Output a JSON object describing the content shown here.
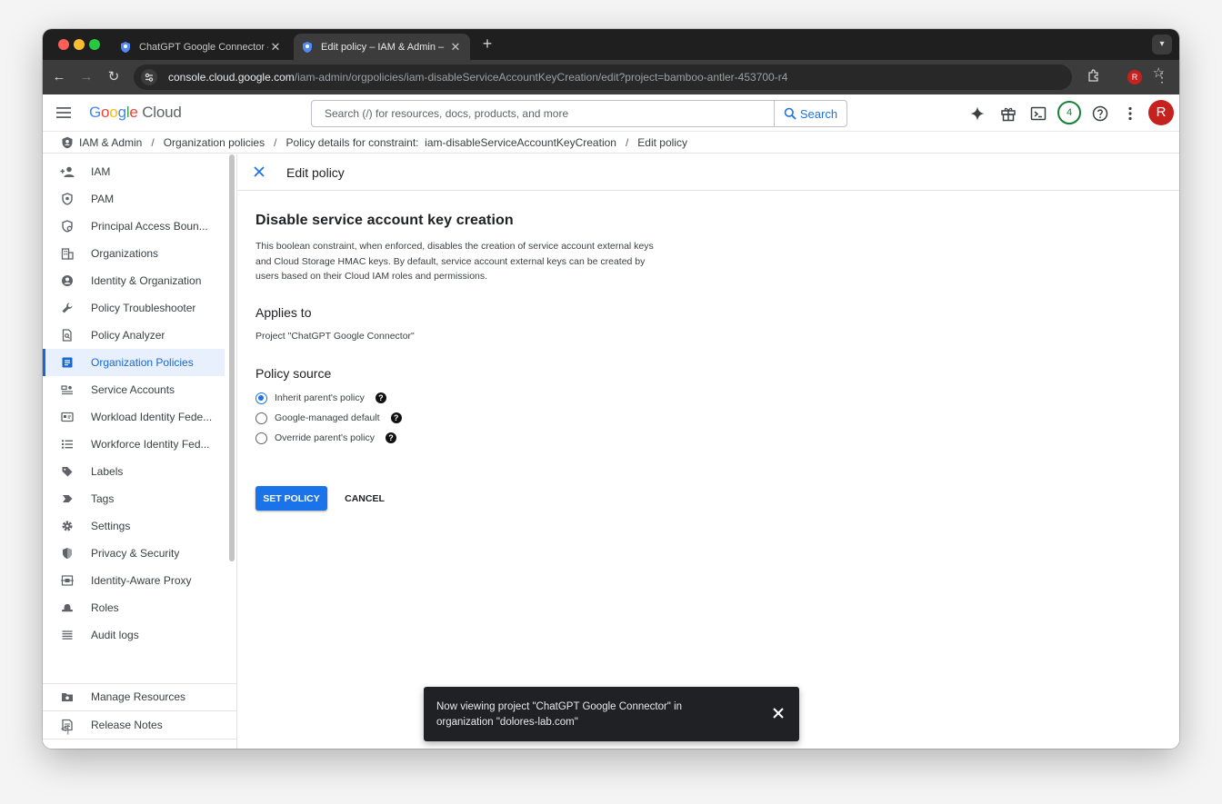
{
  "browser": {
    "tabs": [
      {
        "title": "ChatGPT Google Connector – ",
        "active": false
      },
      {
        "title": "Edit policy – IAM & Admin – ",
        "active": true
      }
    ],
    "url_host": "console.cloud.google.com",
    "url_path": "/iam-admin/orgpolicies/iam-disableServiceAccountKeyCreation/edit?project=bamboo-antler-453700-r4",
    "profile_initial": "R"
  },
  "header": {
    "logo_google": [
      "G",
      "o",
      "o",
      "g",
      "l",
      "e"
    ],
    "logo_cloud": "Cloud",
    "search_placeholder": "Search (/) for resources, docs, products, and more",
    "search_button": "Search",
    "notification_count": "4",
    "avatar_initial": "R"
  },
  "breadcrumb": {
    "items": [
      "IAM & Admin",
      "Organization policies",
      "Policy details for constraint:  iam-disableServiceAccountKeyCreation",
      "Edit policy"
    ],
    "separator": "/"
  },
  "sidebar": {
    "items": [
      {
        "label": "IAM",
        "icon": "person-add-icon"
      },
      {
        "label": "PAM",
        "icon": "shield-key-icon"
      },
      {
        "label": "Principal Access Boun...",
        "icon": "policy-boundary-icon"
      },
      {
        "label": "Organizations",
        "icon": "building-icon"
      },
      {
        "label": "Identity & Organization",
        "icon": "account-circle-icon"
      },
      {
        "label": "Policy Troubleshooter",
        "icon": "wrench-icon"
      },
      {
        "label": "Policy Analyzer",
        "icon": "document-search-icon"
      },
      {
        "label": "Organization Policies",
        "icon": "list-document-icon",
        "active": true
      },
      {
        "label": "Service Accounts",
        "icon": "service-account-icon"
      },
      {
        "label": "Workload Identity Fede...",
        "icon": "id-card-icon"
      },
      {
        "label": "Workforce Identity Fed...",
        "icon": "list-icon"
      },
      {
        "label": "Labels",
        "icon": "label-icon"
      },
      {
        "label": "Tags",
        "icon": "tag-icon"
      },
      {
        "label": "Settings",
        "icon": "gear-icon"
      },
      {
        "label": "Privacy & Security",
        "icon": "security-shield-icon"
      },
      {
        "label": "Identity-Aware Proxy",
        "icon": "proxy-icon"
      },
      {
        "label": "Roles",
        "icon": "roles-hat-icon"
      },
      {
        "label": "Audit logs",
        "icon": "lines-icon"
      }
    ],
    "footer_items": [
      {
        "label": "Manage Resources",
        "icon": "folder-gear-icon"
      },
      {
        "label": "Release Notes",
        "icon": "notes-icon"
      }
    ],
    "collapse_label": "<|"
  },
  "main": {
    "edit_title": "Edit policy",
    "heading": "Disable service account key creation",
    "description": "This boolean constraint, when enforced, disables the creation of service account external keys and Cloud Storage HMAC keys. By default, service account external keys can be created by users based on their Cloud IAM roles and permissions.",
    "applies_to_heading": "Applies to",
    "applies_to_value": "Project \"ChatGPT Google Connector\"",
    "policy_source_heading": "Policy source",
    "policy_source_options": [
      {
        "label": "Inherit parent's policy",
        "selected": true
      },
      {
        "label": "Google-managed default",
        "selected": false
      },
      {
        "label": "Override parent's policy",
        "selected": false
      }
    ],
    "help_glyph": "?",
    "set_policy_button": "SET POLICY",
    "cancel_button": "CANCEL"
  },
  "snackbar": {
    "text": "Now viewing project \"ChatGPT Google Connector\" in organization \"dolores-lab.com\""
  },
  "colors": {
    "accent": "#1a73e8",
    "active_nav_bg": "#e8f0fe",
    "avatar": "#c5221f",
    "notification": "#188038",
    "snackbar_bg": "#202124"
  }
}
